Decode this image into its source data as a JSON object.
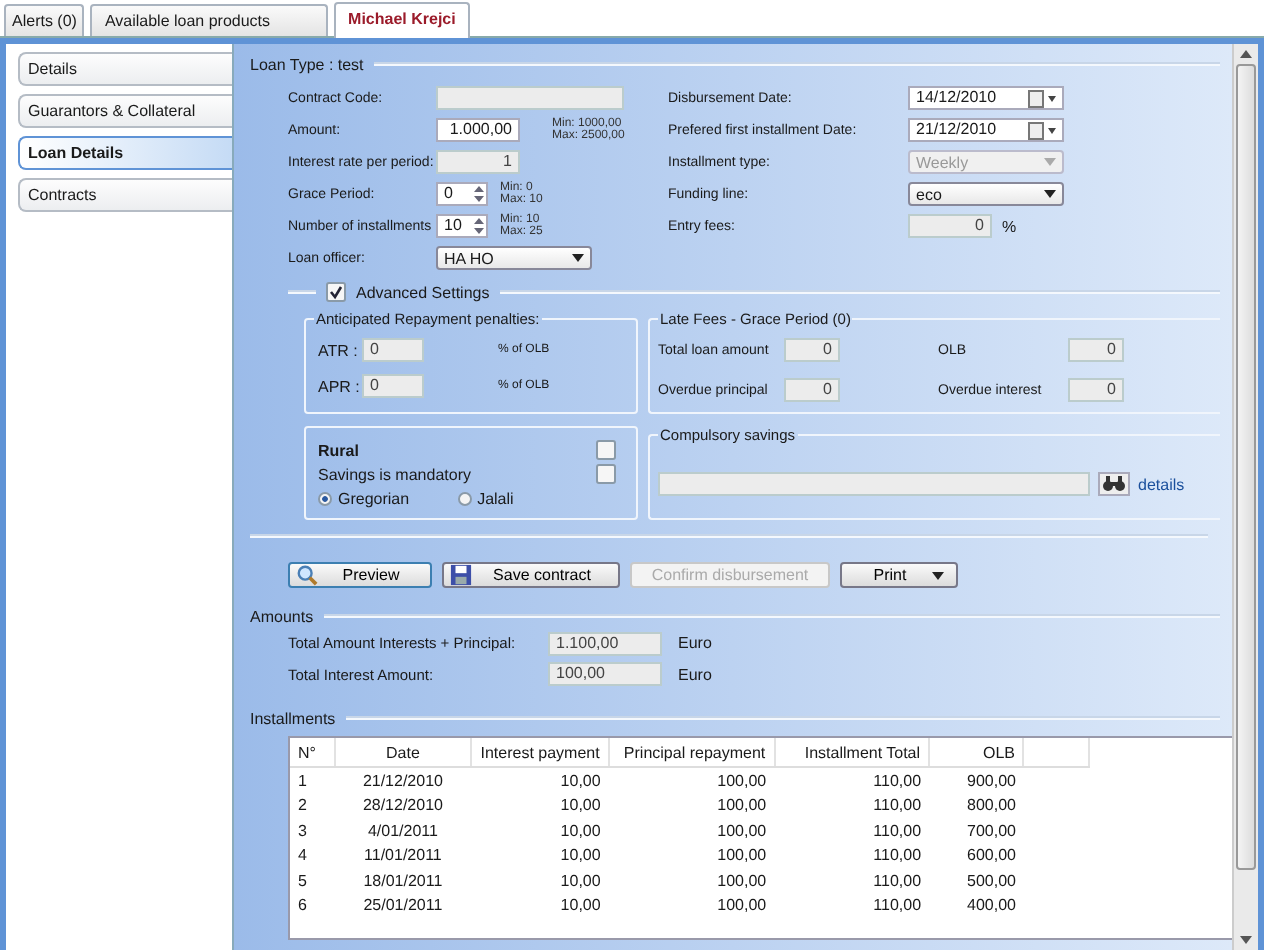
{
  "tabs": [
    {
      "label": "Alerts (0)",
      "selected": false
    },
    {
      "label": "Available loan products",
      "selected": false
    },
    {
      "label": "Michael Krejci",
      "selected": true
    }
  ],
  "sidebar": {
    "items": [
      {
        "label": "Details",
        "selected": false
      },
      {
        "label": "Guarantors & Collateral",
        "selected": false
      },
      {
        "label": "Loan Details",
        "selected": true
      },
      {
        "label": "Contracts",
        "selected": false
      }
    ]
  },
  "loan_type": "Loan Type : test",
  "fields_left": [
    {
      "kind": "text",
      "label": "Contract Code:",
      "disabled": true,
      "wide": true
    },
    {
      "kind": "text",
      "label": "Amount:",
      "value": "1.000,00",
      "disabled": false,
      "hint": [
        "Min: 1000,00",
        "Max: 2500,00"
      ]
    },
    {
      "kind": "text",
      "label": "Interest rate per period:",
      "value": "1",
      "disabled": true
    },
    {
      "kind": "spin",
      "label": "Grace Period:",
      "value": "0",
      "hint": [
        "Min: 0",
        "Max: 10"
      ]
    },
    {
      "kind": "spin",
      "label": "Number of installments",
      "value": "10",
      "hint": [
        "Min: 10",
        "Max: 25"
      ]
    },
    {
      "kind": "dropdown",
      "label": "Loan officer:",
      "value": "HA HO",
      "disabled": false
    }
  ],
  "fields_right": [
    {
      "kind": "date",
      "label": "Disbursement Date:",
      "value": "14/12/2010"
    },
    {
      "kind": "date",
      "label": "Prefered first installment Date:",
      "value": "21/12/2010"
    },
    {
      "kind": "dropdown",
      "label": "Installment type:",
      "value": "Weekly",
      "disabled": true
    },
    {
      "kind": "dropdown",
      "label": "Funding line:",
      "value": "eco",
      "disabled": false
    },
    {
      "kind": "text",
      "label": "Entry fees:",
      "value": "0",
      "disabled": true,
      "suffix": "%"
    }
  ],
  "advanced": {
    "label": "Advanced Settings",
    "checked": true
  },
  "penalties": {
    "title": "Anticipated Repayment penalties:",
    "rows": [
      {
        "label": "ATR :",
        "value": "0",
        "unit": "% of OLB"
      },
      {
        "label": "APR :",
        "value": "0",
        "unit": "% of OLB"
      }
    ]
  },
  "late_fees": {
    "title": "Late Fees - Grace Period (0)",
    "fields": [
      {
        "label": "Total loan amount",
        "value": "0"
      },
      {
        "label": "OLB",
        "value": "0"
      },
      {
        "label": "Overdue principal",
        "value": "0"
      },
      {
        "label": "Overdue interest",
        "value": "0"
      }
    ]
  },
  "rural": {
    "title": "Rural",
    "checked": false,
    "savings": {
      "label": "Savings is mandatory",
      "checked": false
    },
    "calendar": [
      {
        "label": "Gregorian",
        "selected": true
      },
      {
        "label": "Jalali",
        "selected": false
      }
    ]
  },
  "compulsory_savings": {
    "title": "Compulsory savings",
    "link": "details"
  },
  "buttons": [
    {
      "kind": "search",
      "label": "Preview",
      "disabled": false
    },
    {
      "kind": "save",
      "label": "Save contract",
      "disabled": false
    },
    {
      "kind": "plain",
      "label": "Confirm disbursement",
      "disabled": true
    },
    {
      "kind": "menu",
      "label": "Print",
      "disabled": false
    }
  ],
  "amounts": {
    "title": "Amounts",
    "rows": [
      {
        "label": "Total Amount Interests + Principal:",
        "value": "1.100,00",
        "unit": "Euro"
      },
      {
        "label": "Total Interest Amount:",
        "value": "100,00",
        "unit": "Euro"
      }
    ]
  },
  "installments": {
    "title": "Installments",
    "columns": [
      "N°",
      "Date",
      "Interest payment",
      "Principal repayment",
      "Installment Total",
      "OLB"
    ],
    "rows": [
      [
        "1",
        "21/12/2010",
        "10,00",
        "100,00",
        "110,00",
        "900,00"
      ],
      [
        "2",
        "28/12/2010",
        "10,00",
        "100,00",
        "110,00",
        "800,00"
      ],
      [
        "3",
        "4/01/2011",
        "10,00",
        "100,00",
        "110,00",
        "700,00"
      ],
      [
        "4",
        "11/01/2011",
        "10,00",
        "100,00",
        "110,00",
        "600,00"
      ],
      [
        "5",
        "18/01/2011",
        "10,00",
        "100,00",
        "110,00",
        "500,00"
      ],
      [
        "6",
        "25/01/2011",
        "10,00",
        "100,00",
        "110,00",
        "400,00"
      ]
    ]
  }
}
